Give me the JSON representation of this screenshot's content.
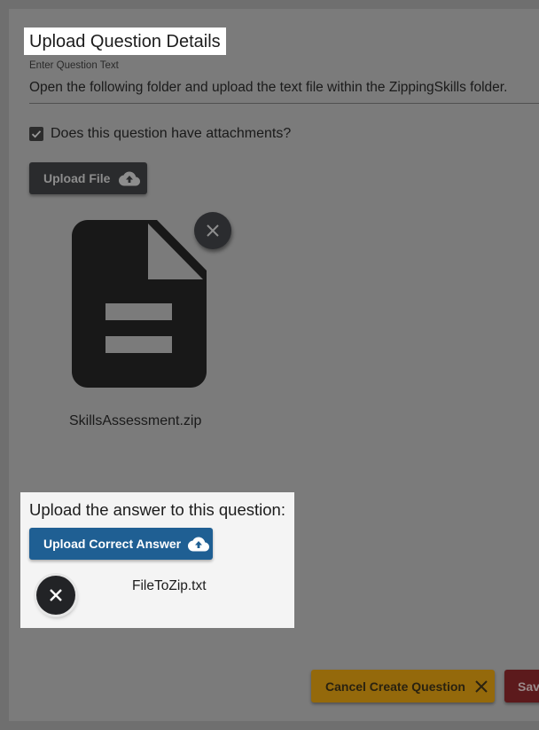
{
  "section": {
    "title": "Upload Question Details"
  },
  "question_text": {
    "label": "Enter Question Text",
    "value": "Open the following folder and upload the text file within the ZippingSkills folder."
  },
  "attachments": {
    "checkbox_label": "Does this question have attachments?",
    "checked": true,
    "upload_button_label": "Upload File",
    "file_name": "SkillsAssessment.zip"
  },
  "answer": {
    "title": "Upload the answer to this question:",
    "upload_button_label": "Upload Correct Answer",
    "file_name": "FileToZip.txt"
  },
  "footer": {
    "cancel_label": "Cancel Create Question",
    "save_label": "Save"
  },
  "colors": {
    "overlay_bg": "#6f6f6f",
    "upload_answer_button": "#1f5f93",
    "cancel_button": "#94690b",
    "save_button": "#5c1a1c",
    "highlight": "#f4f4f4"
  },
  "icons": [
    "check-icon",
    "cloud-upload-icon",
    "document-icon",
    "close-icon"
  ]
}
